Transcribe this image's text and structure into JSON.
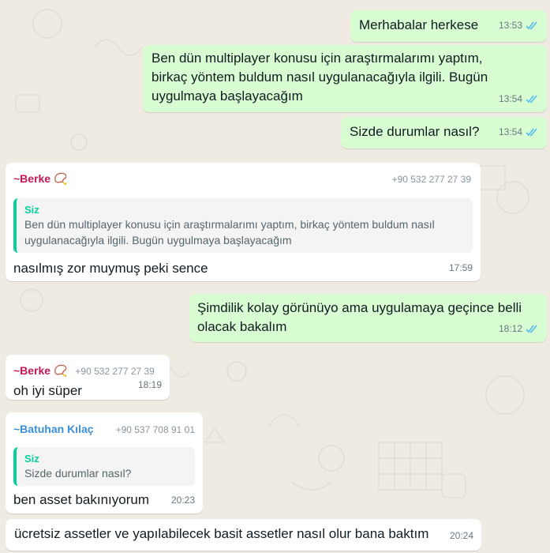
{
  "colors": {
    "background": "#efeae2",
    "outgoing": "#d9fdd3",
    "incoming": "#ffffff",
    "read_ticks": "#53bdeb",
    "berke_name": "#c2185b",
    "batuhan_name": "#3b8fd4",
    "quote_bar": "#06cf9c"
  },
  "messages": [
    {
      "type": "outgoing",
      "text": "Merhabalar herkese",
      "time": "13:53",
      "status_icon": "double-check-read-icon"
    },
    {
      "type": "outgoing",
      "text": "Ben dün multiplayer konusu için araştırmalarımı yaptım, birkaç yöntem buldum nasıl uygulanacağıyla ilgili. Bugün uygulmaya başlayacağım",
      "time": "13:54",
      "status_icon": "double-check-read-icon"
    },
    {
      "type": "outgoing",
      "text": "Sizde durumlar nasıl?",
      "time": "13:54",
      "status_icon": "double-check-read-icon"
    },
    {
      "type": "incoming",
      "sender": "~Berke 📿",
      "phone": "+90 532 277 27 39",
      "quote": {
        "author": "Siz",
        "text": "Ben dün multiplayer konusu için araştırmalarımı yaptım, birkaç yöntem buldum nasıl uygulanacağıyla ilgili. Bugün uygulmaya başlayacağım"
      },
      "text": "nasılmış zor muymuş peki sence",
      "time": "17:59"
    },
    {
      "type": "outgoing",
      "text": "Şimdilik kolay görünüyo ama uygulamaya geçince belli olacak bakalım",
      "time": "18:12",
      "status_icon": "double-check-read-icon"
    },
    {
      "type": "incoming",
      "sender": "~Berke 📿",
      "phone": "+90 532 277 27 39",
      "text": "oh iyi süper",
      "time": "18:19"
    },
    {
      "type": "incoming",
      "sender": "~Batuhan Kılaç",
      "phone": "+90 537 708 91 01",
      "quote": {
        "author": "Siz",
        "text": "Sizde durumlar nasıl?"
      },
      "text": "ben asset bakınıyorum",
      "time": "20:23"
    },
    {
      "type": "incoming",
      "text": "ücretsiz assetler ve yapılabilecek basit assetler nasıl olur bana baktım",
      "time": "20:24"
    }
  ]
}
